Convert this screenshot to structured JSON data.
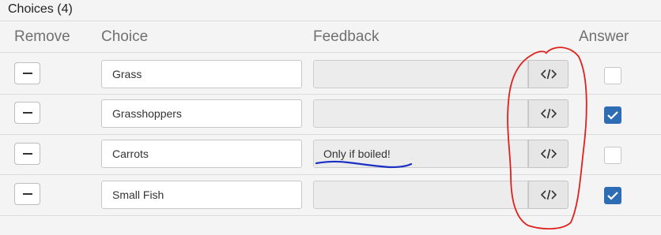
{
  "section_title": "Choices (4)",
  "columns": {
    "remove": "Remove",
    "choice": "Choice",
    "feedback": "Feedback",
    "answer": "Answer"
  },
  "rows": [
    {
      "choice": "Grass",
      "feedback": "",
      "answer": false
    },
    {
      "choice": "Grasshoppers",
      "feedback": "",
      "answer": true
    },
    {
      "choice": "Carrots",
      "feedback": "Only if boiled!",
      "answer": false
    },
    {
      "choice": "Small Fish",
      "feedback": "",
      "answer": true
    }
  ],
  "icons": {
    "remove": "minus-icon",
    "feedback_editor": "code-icon",
    "checked": "checkmark-icon"
  },
  "colors": {
    "checkbox_checked": "#2e6db4",
    "annotation_red": "#e0201c",
    "annotation_blue": "#1a2fc4"
  }
}
